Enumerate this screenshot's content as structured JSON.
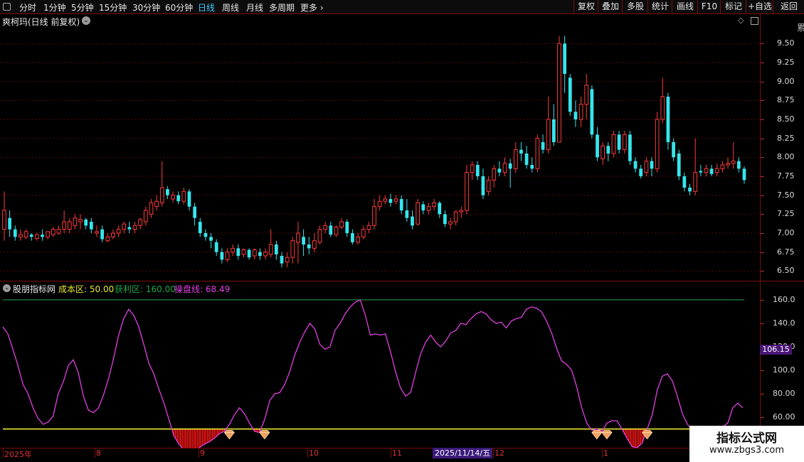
{
  "toolbar": {
    "periods": [
      "分时",
      "1分钟",
      "5分钟",
      "15分钟",
      "30分钟",
      "60分钟",
      "日线",
      "周线",
      "月线",
      "多周期",
      "更多"
    ],
    "active_period": "日线",
    "right_buttons": [
      "复权",
      "叠加",
      "多股",
      "统计",
      "画线",
      "F10",
      "标记",
      "+自选",
      "返回"
    ]
  },
  "price_header": {
    "title": "爽柯玛(日线 前复权)"
  },
  "price_axis": {
    "ticks": [
      "9.50",
      "9.25",
      "9.00",
      "8.75",
      "8.50",
      "8.25",
      "8.00",
      "7.75",
      "7.50",
      "7.25",
      "7.00",
      "6.75",
      "6.50"
    ]
  },
  "indicator_header": {
    "name": "股朋指标网",
    "items": [
      {
        "label": "成本区: 50.00",
        "color": "#e8e830"
      },
      {
        "label": "获利区: 160.00",
        "color": "#21a84a"
      },
      {
        "label": "操盘线: 68.49",
        "color": "#e040e0"
      }
    ]
  },
  "indicator_axis": {
    "ticks": [
      "160.0",
      "140.0",
      "120.0",
      "100.0",
      "80.00",
      "60.00"
    ],
    "current_value": "106.15"
  },
  "date_axis": {
    "labels": [
      "2025年",
      "8",
      "9",
      "10",
      "11",
      "12",
      "1"
    ],
    "cursor_date": "2025/11/14/五"
  },
  "watermark": {
    "title": "指标公式网",
    "url": "www.zbgs3.com"
  },
  "colors": {
    "up": "#ff3b3b",
    "down": "#35e6ee",
    "ma_line": "#e040e0",
    "cost_line": "#e8e830",
    "profit_line": "#21a84a",
    "grid": "#5a0a0a"
  },
  "chart_data": [
    {
      "type": "candlestick",
      "title": "爽柯玛(日线 前复权)",
      "ylim": [
        6.4,
        9.7
      ],
      "ohlc": [
        [
          7.05,
          7.55,
          7.3,
          6.9
        ],
        [
          7.2,
          7.3,
          7.05,
          6.95
        ],
        [
          7.05,
          7.1,
          6.95,
          6.9
        ],
        [
          6.95,
          7.05,
          6.98,
          6.9
        ],
        [
          6.95,
          7.05,
          7.02,
          6.92
        ],
        [
          6.98,
          7.0,
          6.95,
          6.9
        ],
        [
          6.93,
          7.0,
          6.98,
          6.9
        ],
        [
          6.98,
          7.05,
          6.95,
          6.9
        ],
        [
          6.95,
          7.0,
          7.02,
          6.92
        ],
        [
          6.98,
          7.08,
          7.05,
          6.95
        ],
        [
          7.0,
          7.1,
          7.05,
          6.98
        ],
        [
          7.05,
          7.3,
          7.15,
          7.0
        ],
        [
          7.05,
          7.2,
          7.15,
          7.0
        ],
        [
          7.1,
          7.25,
          7.2,
          7.05
        ],
        [
          7.15,
          7.25,
          7.18,
          7.05
        ],
        [
          7.18,
          7.2,
          7.1,
          7.05
        ],
        [
          7.15,
          7.2,
          7.05,
          7.0
        ],
        [
          7.0,
          7.1,
          7.02,
          6.95
        ],
        [
          7.05,
          7.1,
          6.92,
          6.88
        ],
        [
          6.9,
          7.0,
          6.95,
          6.88
        ],
        [
          6.95,
          7.05,
          7.0,
          6.92
        ],
        [
          7.0,
          7.1,
          7.05,
          6.95
        ],
        [
          7.05,
          7.15,
          7.12,
          7.0
        ],
        [
          7.08,
          7.15,
          7.05,
          7.0
        ],
        [
          7.05,
          7.15,
          7.1,
          7.0
        ],
        [
          7.1,
          7.2,
          7.18,
          7.05
        ],
        [
          7.15,
          7.35,
          7.3,
          7.1
        ],
        [
          7.25,
          7.45,
          7.4,
          7.2
        ],
        [
          7.35,
          7.5,
          7.42,
          7.3
        ],
        [
          7.4,
          7.95,
          7.6,
          7.35
        ],
        [
          7.58,
          7.62,
          7.5,
          7.45
        ],
        [
          7.45,
          7.55,
          7.5,
          7.4
        ],
        [
          7.5,
          7.55,
          7.42,
          7.38
        ],
        [
          7.42,
          7.6,
          7.55,
          7.38
        ],
        [
          7.55,
          7.58,
          7.35,
          7.3
        ],
        [
          7.35,
          7.4,
          7.2,
          7.1
        ],
        [
          7.15,
          7.2,
          7.0,
          6.95
        ],
        [
          7.0,
          7.05,
          6.95,
          6.9
        ],
        [
          6.95,
          7.0,
          6.9,
          6.8
        ],
        [
          6.88,
          6.92,
          6.75,
          6.7
        ],
        [
          6.75,
          6.8,
          6.65,
          6.6
        ],
        [
          6.65,
          6.8,
          6.75,
          6.62
        ],
        [
          6.75,
          6.85,
          6.8,
          6.7
        ],
        [
          6.8,
          6.85,
          6.7,
          6.65
        ],
        [
          6.72,
          6.8,
          6.78,
          6.68
        ],
        [
          6.78,
          6.8,
          6.68,
          6.65
        ],
        [
          6.7,
          6.8,
          6.78,
          6.65
        ],
        [
          6.75,
          6.8,
          6.7,
          6.65
        ],
        [
          6.7,
          6.8,
          6.75,
          6.65
        ],
        [
          6.72,
          7.05,
          6.85,
          6.68
        ],
        [
          6.85,
          6.9,
          6.72,
          6.65
        ],
        [
          6.7,
          6.75,
          6.6,
          6.55
        ],
        [
          6.62,
          6.75,
          6.68,
          6.55
        ],
        [
          6.68,
          6.95,
          6.9,
          6.6
        ],
        [
          6.88,
          7.15,
          7.0,
          6.6
        ],
        [
          6.95,
          7.05,
          6.85,
          6.7
        ],
        [
          6.85,
          6.95,
          6.8,
          6.72
        ],
        [
          6.8,
          7.0,
          6.9,
          6.75
        ],
        [
          6.88,
          7.1,
          7.05,
          6.85
        ],
        [
          7.05,
          7.15,
          7.1,
          7.0
        ],
        [
          7.1,
          7.15,
          6.98,
          6.95
        ],
        [
          6.98,
          7.1,
          7.08,
          6.95
        ],
        [
          7.08,
          7.2,
          7.15,
          7.05
        ],
        [
          7.15,
          7.18,
          7.0,
          6.95
        ],
        [
          7.0,
          7.05,
          6.88,
          6.85
        ],
        [
          6.88,
          7.0,
          6.95,
          6.85
        ],
        [
          6.95,
          7.1,
          7.05,
          6.92
        ],
        [
          7.05,
          7.15,
          7.1,
          7.0
        ],
        [
          7.1,
          7.45,
          7.35,
          7.05
        ],
        [
          7.35,
          7.5,
          7.42,
          7.3
        ],
        [
          7.42,
          7.5,
          7.45,
          7.38
        ],
        [
          7.45,
          7.52,
          7.4,
          7.35
        ],
        [
          7.42,
          7.5,
          7.45,
          7.38
        ],
        [
          7.45,
          7.5,
          7.3,
          7.25
        ],
        [
          7.3,
          7.45,
          7.2,
          7.15
        ],
        [
          7.22,
          7.3,
          7.1,
          7.05
        ],
        [
          7.12,
          7.45,
          7.4,
          7.1
        ],
        [
          7.38,
          7.42,
          7.3,
          7.25
        ],
        [
          7.3,
          7.4,
          7.35,
          7.25
        ],
        [
          7.35,
          7.45,
          7.4,
          7.3
        ],
        [
          7.4,
          7.42,
          7.25,
          7.2
        ],
        [
          7.25,
          7.3,
          7.12,
          7.08
        ],
        [
          7.12,
          7.2,
          7.15,
          7.05
        ],
        [
          7.15,
          7.3,
          7.28,
          7.1
        ],
        [
          7.28,
          7.35,
          7.3,
          7.2
        ],
        [
          7.3,
          7.9,
          7.8,
          7.25
        ],
        [
          7.8,
          7.95,
          7.9,
          7.7
        ],
        [
          7.9,
          7.95,
          7.75,
          7.7
        ],
        [
          7.75,
          7.85,
          7.5,
          7.45
        ],
        [
          7.55,
          7.75,
          7.7,
          7.5
        ],
        [
          7.7,
          7.9,
          7.85,
          7.6
        ],
        [
          7.85,
          7.95,
          7.8,
          7.75
        ],
        [
          7.8,
          8.0,
          7.92,
          7.75
        ],
        [
          7.92,
          7.98,
          7.85,
          7.6
        ],
        [
          7.85,
          8.2,
          8.1,
          7.8
        ],
        [
          8.1,
          8.2,
          8.05,
          7.95
        ],
        [
          8.05,
          8.15,
          7.9,
          7.85
        ],
        [
          7.9,
          8.0,
          7.85,
          7.8
        ],
        [
          7.85,
          8.3,
          8.25,
          7.8
        ],
        [
          8.2,
          8.3,
          8.1,
          8.05
        ],
        [
          8.1,
          8.8,
          8.5,
          8.05
        ],
        [
          8.5,
          8.7,
          8.2,
          8.15
        ],
        [
          8.2,
          9.6,
          9.5,
          8.45
        ],
        [
          9.5,
          9.6,
          9.1,
          8.85
        ],
        [
          9.05,
          9.1,
          8.6,
          8.55
        ],
        [
          8.6,
          8.75,
          8.5,
          8.4
        ],
        [
          8.5,
          8.8,
          8.7,
          8.4
        ],
        [
          8.7,
          9.1,
          8.95,
          8.5
        ],
        [
          8.9,
          8.95,
          8.3,
          8.25
        ],
        [
          8.3,
          8.4,
          8.0,
          7.95
        ],
        [
          7.98,
          8.2,
          8.15,
          7.9
        ],
        [
          8.15,
          8.2,
          8.05,
          7.95
        ],
        [
          8.05,
          8.35,
          8.3,
          8.0
        ],
        [
          8.3,
          8.35,
          8.1,
          8.05
        ],
        [
          8.1,
          8.35,
          8.3,
          8.05
        ],
        [
          8.3,
          8.35,
          7.95,
          7.9
        ],
        [
          7.95,
          8.0,
          7.85,
          7.8
        ],
        [
          7.85,
          7.9,
          7.75,
          7.72
        ],
        [
          7.8,
          8.0,
          7.95,
          7.75
        ],
        [
          7.95,
          8.0,
          7.85,
          7.75
        ],
        [
          7.85,
          8.6,
          8.5,
          7.8
        ],
        [
          8.5,
          9.05,
          8.8,
          8.45
        ],
        [
          8.8,
          8.85,
          8.2,
          8.1
        ],
        [
          8.2,
          8.25,
          8.0,
          7.95
        ],
        [
          8.05,
          8.1,
          7.75,
          7.7
        ],
        [
          7.75,
          7.8,
          7.6,
          7.55
        ],
        [
          7.6,
          7.65,
          7.55,
          7.5
        ],
        [
          7.55,
          8.25,
          7.8,
          7.5
        ],
        [
          7.82,
          7.9,
          7.8,
          7.75
        ],
        [
          7.8,
          7.9,
          7.85,
          7.75
        ],
        [
          7.85,
          7.9,
          7.78,
          7.75
        ],
        [
          7.8,
          7.92,
          7.85,
          7.75
        ],
        [
          7.85,
          7.95,
          7.9,
          7.8
        ],
        [
          7.9,
          8.0,
          7.92,
          7.85
        ],
        [
          7.92,
          8.2,
          7.95,
          7.85
        ],
        [
          7.95,
          8.0,
          7.85,
          7.8
        ],
        [
          7.85,
          7.88,
          7.7,
          7.65
        ]
      ]
    },
    {
      "type": "line",
      "series_name": "操盘线",
      "ylim": [
        34,
        166
      ],
      "cost_level": 50,
      "profit_level": 160,
      "values": [
        137,
        131,
        118,
        104,
        88,
        80,
        68,
        59,
        54,
        56,
        61,
        80,
        90,
        104,
        109,
        98,
        78,
        66,
        64,
        68,
        79,
        93,
        110,
        130,
        144,
        152,
        147,
        137,
        122,
        106,
        97,
        84,
        72,
        58,
        44,
        37,
        32,
        29,
        30,
        34,
        37,
        39,
        42,
        46,
        48,
        54,
        62,
        68,
        63,
        55,
        48,
        47,
        58,
        74,
        80,
        81,
        88,
        99,
        113,
        124,
        133,
        140,
        135,
        122,
        118,
        120,
        134,
        140,
        148,
        154,
        158,
        160,
        147,
        130,
        131,
        130,
        131,
        116,
        99,
        85,
        78,
        81,
        98,
        114,
        124,
        130,
        124,
        120,
        125,
        132,
        134,
        140,
        139,
        144,
        148,
        150,
        148,
        143,
        140,
        141,
        136,
        142,
        144,
        145,
        152,
        154,
        153,
        150,
        142,
        132,
        119,
        108,
        105,
        100,
        86,
        68,
        55,
        49,
        50,
        48,
        55,
        57,
        57,
        50,
        42,
        35,
        34,
        38,
        50,
        62,
        83,
        95,
        97,
        91,
        78,
        63,
        54,
        49,
        48,
        48,
        49,
        50,
        52,
        52,
        55,
        68,
        72,
        68
      ]
    }
  ]
}
